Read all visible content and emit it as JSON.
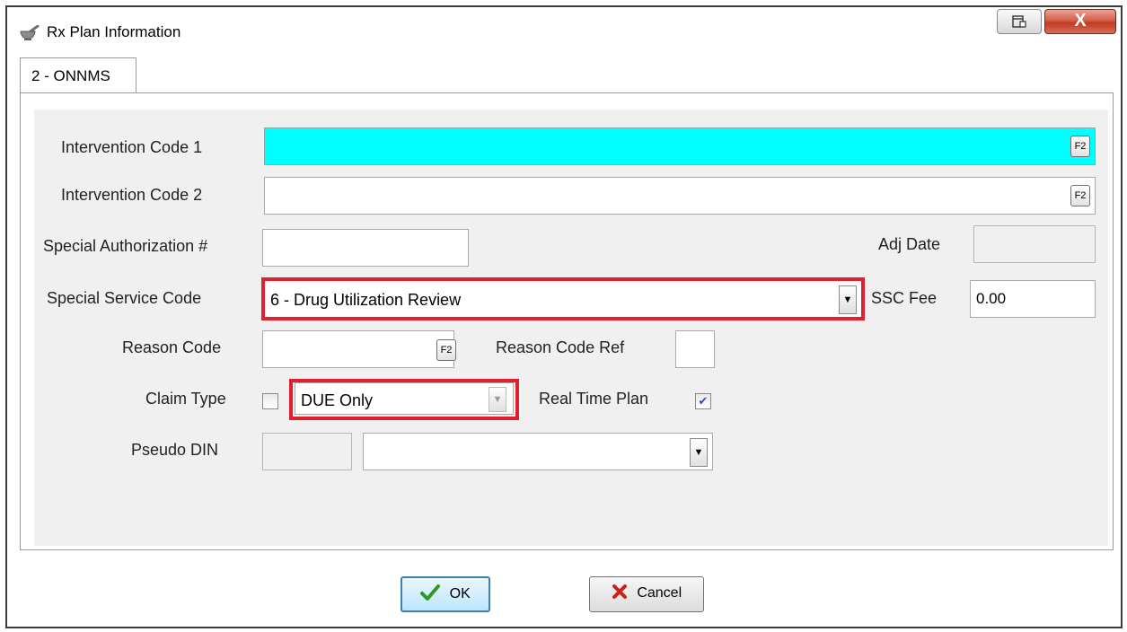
{
  "window": {
    "title": "Rx Plan Information",
    "close_glyph": "X",
    "icons": {
      "app": "mortar-pestle-icon",
      "restore": "restore-icon",
      "close": "close-icon"
    }
  },
  "tabs": [
    {
      "label": "2 - ONNMS",
      "active": true
    }
  ],
  "form": {
    "intervention_code_1": {
      "label": "Intervention Code 1",
      "value": "",
      "lookup": "F2"
    },
    "intervention_code_2": {
      "label": "Intervention Code 2",
      "value": "",
      "lookup": "F2"
    },
    "special_authorization": {
      "label": "Special Authorization #",
      "value": ""
    },
    "adj_date": {
      "label": "Adj Date",
      "value": ""
    },
    "special_service_code": {
      "label": "Special Service Code",
      "value": "6 - Drug Utilization Review"
    },
    "ssc_fee": {
      "label": "SSC Fee",
      "value": "0.00"
    },
    "reason_code": {
      "label": "Reason Code",
      "value": "",
      "lookup": "F2"
    },
    "reason_code_ref": {
      "label": "Reason Code Ref",
      "value": ""
    },
    "claim_type": {
      "label": "Claim Type",
      "checked": false,
      "value": "DUE Only"
    },
    "real_time_plan": {
      "label": "Real Time Plan",
      "checked": true
    },
    "pseudo_din": {
      "label": "Pseudo DIN",
      "value": "",
      "select_value": ""
    }
  },
  "buttons": {
    "ok": "OK",
    "cancel": "Cancel"
  },
  "colors": {
    "highlight_field": "#00ffff",
    "annotation_box": "#e0202e"
  }
}
